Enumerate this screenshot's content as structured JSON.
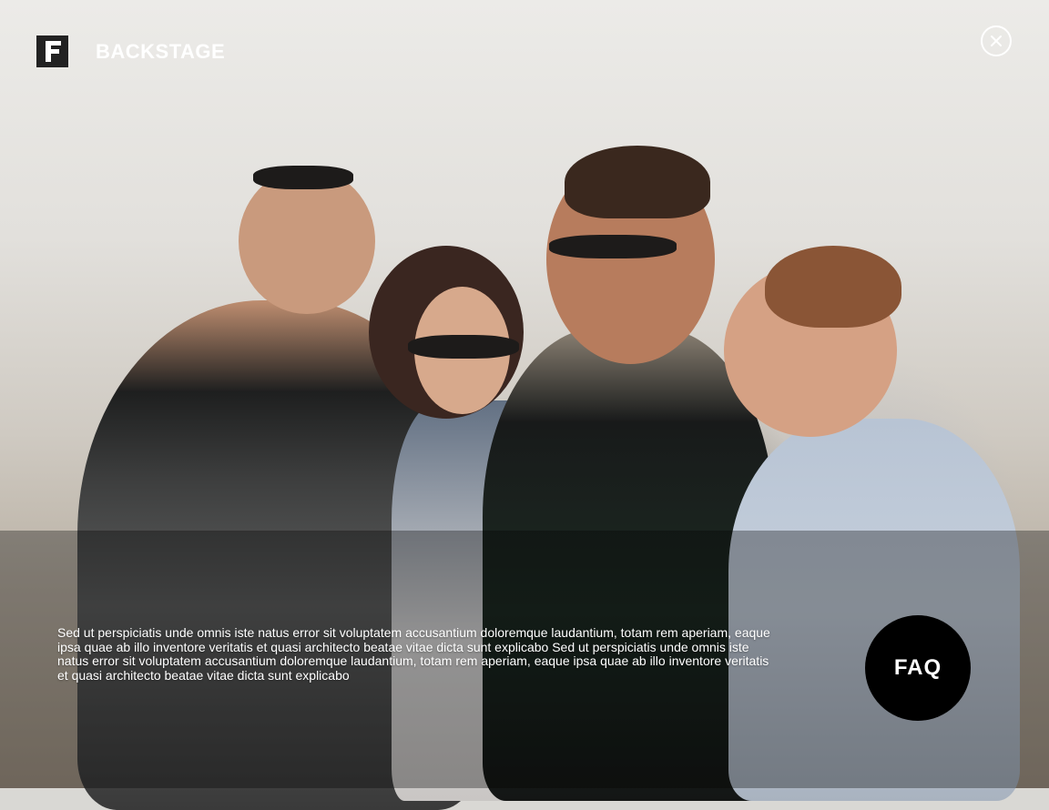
{
  "header": {
    "logo_icon": "backstage-logo-icon",
    "brand_name": "BACKSTAGE",
    "close_icon": "close-icon"
  },
  "hero": {
    "description": "Sed ut perspiciatis unde omnis iste natus error sit voluptatem accusantium doloremque laudantium, totam rem aperiam, eaque ipsa quae ab illo inventore veritatis et quasi architecto beatae vitae dicta sunt explicabo Sed ut perspiciatis unde omnis iste natus error sit voluptatem accusantium doloremque laudantium, totam rem aperiam, eaque ipsa quae ab illo inventore veritatis et quasi architecto beatae vitae dicta sunt explicabo"
  },
  "faq": {
    "label": "FAQ"
  },
  "colors": {
    "button_bg": "#000000",
    "text": "#ffffff",
    "logo_bg": "#222222"
  }
}
